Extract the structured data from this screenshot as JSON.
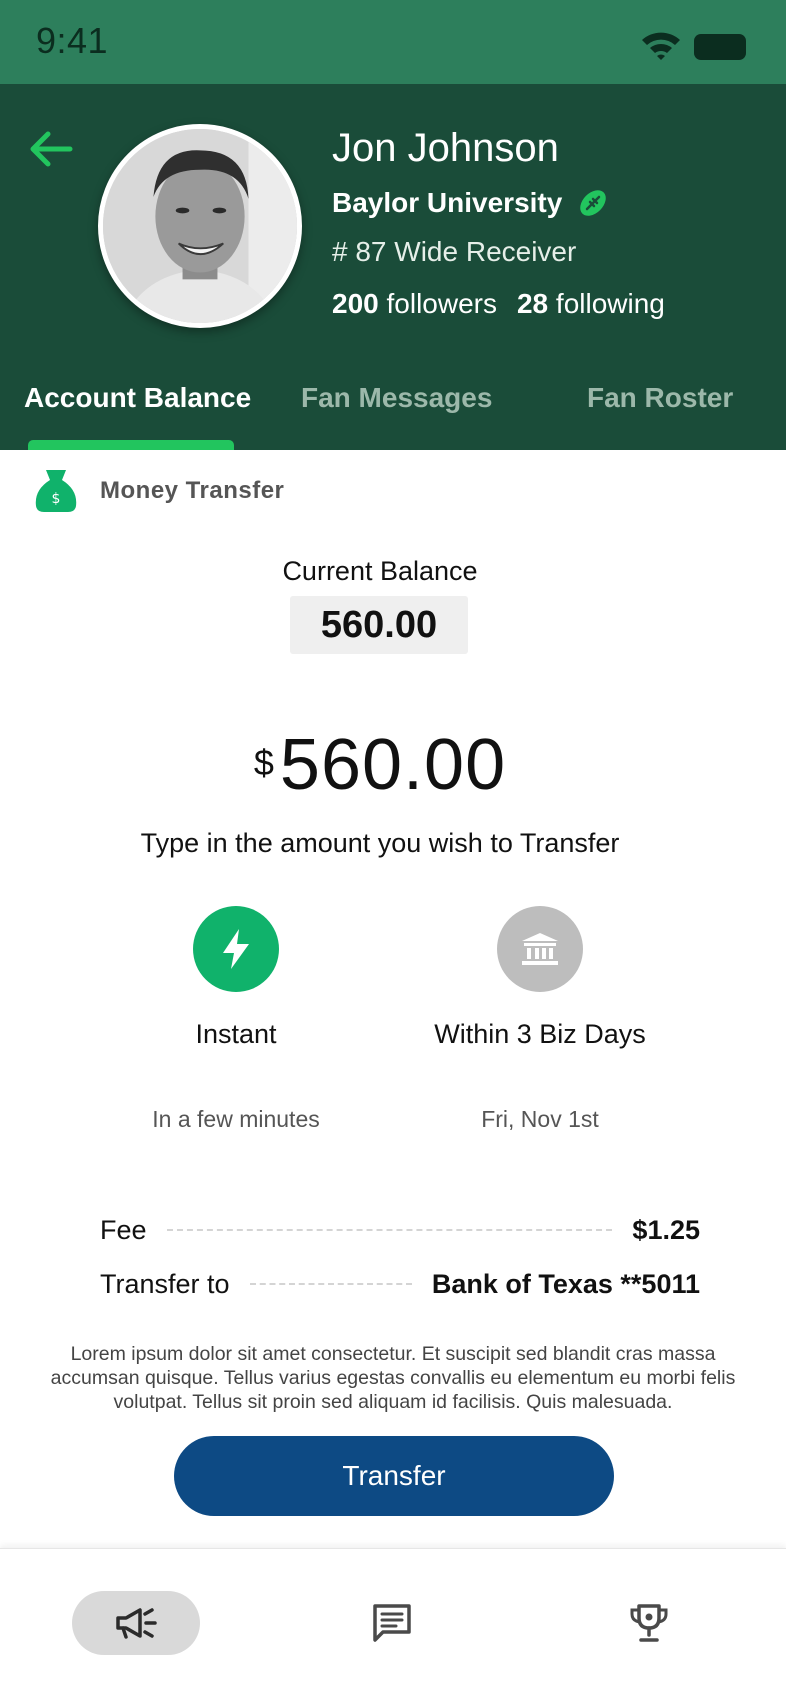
{
  "status_bar": {
    "time": "9:41"
  },
  "profile": {
    "name": "Jon Johnson",
    "school": "Baylor University",
    "position": "# 87 Wide Receiver",
    "followers_count": "200",
    "followers_label": "followers",
    "following_count": "28",
    "following_label": "following"
  },
  "tabs": [
    {
      "label": "Account Balance",
      "active": true
    },
    {
      "label": "Fan Messages",
      "active": false
    },
    {
      "label": "Fan Roster",
      "active": false
    }
  ],
  "section": {
    "title": "Money Transfer"
  },
  "balance": {
    "label": "Current Balance",
    "value": "560.00"
  },
  "amount": {
    "currency": "$",
    "value": "560.00",
    "hint": "Type in the amount you wish to Transfer"
  },
  "options": [
    {
      "title": "Instant",
      "subtitle": "In a few minutes",
      "icon": "lightning-icon",
      "selected": true
    },
    {
      "title": "Within 3 Biz Days",
      "subtitle": "Fri, Nov 1st",
      "icon": "bank-icon",
      "selected": false
    }
  ],
  "details": {
    "fee_label": "Fee",
    "fee_value": "$1.25",
    "transfer_label": "Transfer to",
    "transfer_value": "Bank of Texas **5011"
  },
  "disclaimer": "Lorem ipsum dolor sit amet consectetur. Et suscipit sed blandit cras massa accumsan quisque. Tellus varius egestas convallis eu elementum eu morbi felis volutpat. Tellus sit proin sed aliquam id facilisis. Quis malesuada.",
  "transfer_button": {
    "label": "Transfer"
  },
  "bottom_nav": [
    {
      "icon": "megaphone-icon",
      "active": true
    },
    {
      "icon": "message-icon",
      "active": false
    },
    {
      "icon": "trophy-icon",
      "active": false
    }
  ],
  "colors": {
    "header_bg": "#1a4c39",
    "status_bar_bg": "#2d7f5c",
    "accent_green": "#10b26b",
    "tab_indicator": "#22c55e",
    "button_blue": "#0d4a84"
  }
}
